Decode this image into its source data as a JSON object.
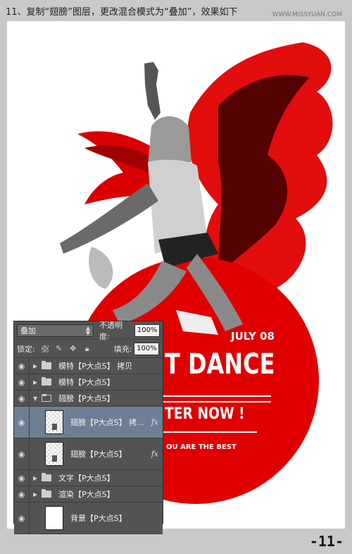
{
  "header": {
    "step_text": "11、复制“翅膀”图层，更改混合模式为“叠加”，效果如下",
    "watermark": "WWW.MISSYUAN.COM"
  },
  "poster": {
    "date": "JULY 08",
    "headline": "T DANCE",
    "enter": "TER NOW !",
    "tagline": "OU ARE THE BEST"
  },
  "layers_panel": {
    "blend_mode": "叠加",
    "opacity_label": "不透明度:",
    "opacity_value": "100%",
    "lock_label": "锁定:",
    "fill_label": "填充:",
    "fill_value": "100%",
    "layers": [
      {
        "name": "模特【P大点S】 拷贝",
        "type": "group"
      },
      {
        "name": "模特【P大点S】",
        "type": "group"
      },
      {
        "name": "翅膀【P大点S】",
        "type": "group-open"
      },
      {
        "name": "翅膀【P大点S】 拷...",
        "type": "layer",
        "fx": "fx"
      },
      {
        "name": "翅膀【P大点S】",
        "type": "layer",
        "fx": "fx"
      },
      {
        "name": "文字【P大点S】",
        "type": "group"
      },
      {
        "name": "渲染【P大点S】",
        "type": "group"
      },
      {
        "name": "背景【P大点S】",
        "type": "layer"
      }
    ]
  },
  "page_number": "-11-",
  "colors": {
    "accent": "#e00000",
    "panel_bg": "#535353",
    "selected_row": "#6d7f94"
  }
}
